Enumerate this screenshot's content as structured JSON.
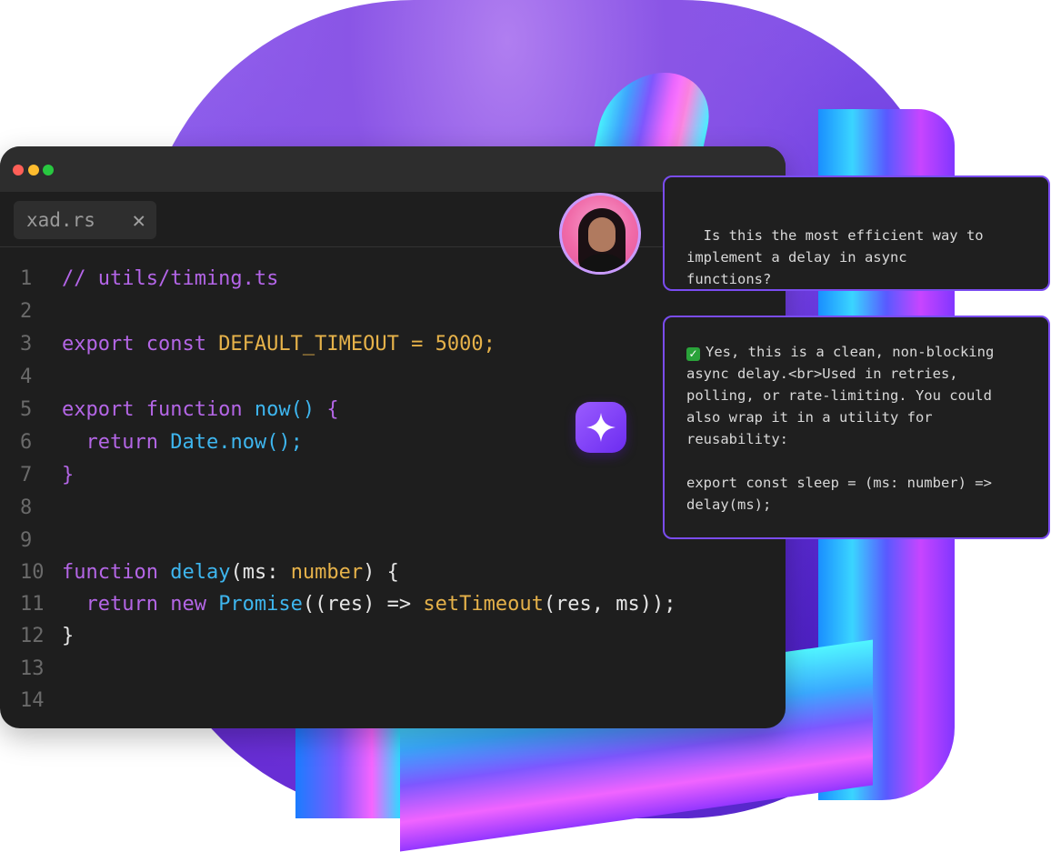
{
  "editor": {
    "tab": {
      "filename": "xad.rs",
      "close_glyph": "✕"
    },
    "lines": [
      {
        "n": "1",
        "tokens": [
          {
            "t": "// utils/timing.ts",
            "c": "c-comment"
          }
        ]
      },
      {
        "n": "2",
        "tokens": []
      },
      {
        "n": "3",
        "tokens": [
          {
            "t": "export const ",
            "c": "c-kw"
          },
          {
            "t": "DEFAULT_TIMEOUT = 5000;",
            "c": "c-const"
          }
        ]
      },
      {
        "n": "4",
        "tokens": []
      },
      {
        "n": "5",
        "tokens": [
          {
            "t": "export function ",
            "c": "c-kw"
          },
          {
            "t": "now() ",
            "c": "c-fn"
          },
          {
            "t": "{",
            "c": "c-brace"
          }
        ]
      },
      {
        "n": "6",
        "tokens": [
          {
            "t": "  return ",
            "c": "c-kw"
          },
          {
            "t": "Date.now();",
            "c": "c-fn"
          }
        ]
      },
      {
        "n": "7",
        "tokens": [
          {
            "t": "}",
            "c": "c-brace"
          }
        ]
      },
      {
        "n": "8",
        "tokens": []
      },
      {
        "n": "9",
        "tokens": []
      },
      {
        "n": "10",
        "tokens": [
          {
            "t": "function ",
            "c": "c-kw"
          },
          {
            "t": "delay",
            "c": "c-fn"
          },
          {
            "t": "(ms: ",
            "c": "c-punct"
          },
          {
            "t": "number",
            "c": "c-type"
          },
          {
            "t": ") {",
            "c": "c-punct"
          }
        ]
      },
      {
        "n": "11",
        "tokens": [
          {
            "t": "  return new ",
            "c": "c-kw"
          },
          {
            "t": "Promise",
            "c": "c-fn"
          },
          {
            "t": "((res) => ",
            "c": "c-punct"
          },
          {
            "t": "setTimeout",
            "c": "c-call"
          },
          {
            "t": "(res, ms));",
            "c": "c-punct"
          }
        ]
      },
      {
        "n": "12",
        "tokens": [
          {
            "t": "}",
            "c": "c-punct"
          }
        ]
      },
      {
        "n": "13",
        "tokens": []
      },
      {
        "n": "14",
        "tokens": []
      }
    ]
  },
  "chat": {
    "question": "Is this the most efficient way to\nimplement a delay in async\nfunctions?",
    "answer_check": "✓",
    "answer": "Yes, this is a clean, non-blocking\nasync delay.<br>Used in retries,\npolling, or rate-limiting. You could\nalso wrap it in a utility for\nreusability:\n\nexport const sleep = (ms: number) =>\ndelay(ms);"
  },
  "icons": {
    "ai_badge": "sparkle-icon",
    "window_controls": [
      "close-dot",
      "minimize-dot",
      "maximize-dot"
    ]
  },
  "colors": {
    "accent": "#7a4cf0",
    "editor_bg": "#1e1e1e",
    "keyword": "#b466e6",
    "function": "#3eb6ef",
    "constant": "#e6b24a"
  }
}
